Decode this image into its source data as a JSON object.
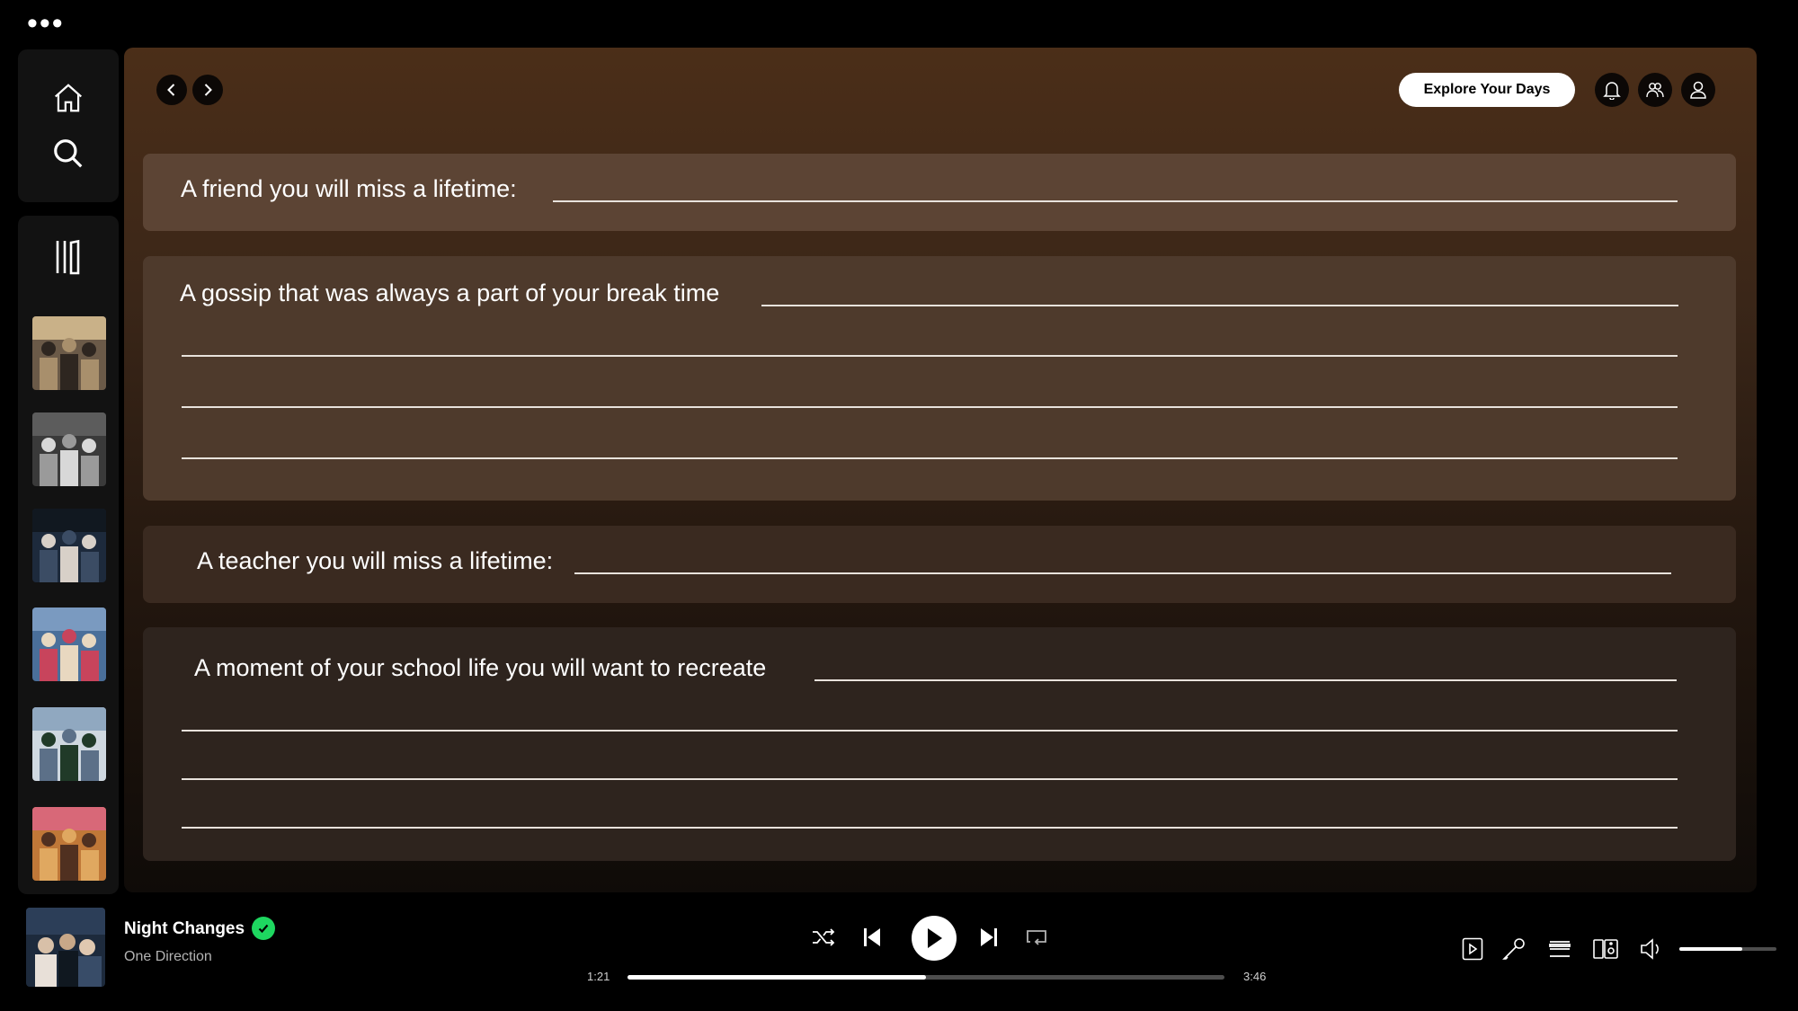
{
  "window": {
    "menu_icon": "more-dots-icon"
  },
  "nav": {
    "home_icon": "home-icon",
    "search_icon": "search-icon",
    "library_icon": "library-icon"
  },
  "library": {
    "thumbnails": [
      {
        "name": "group-photo-1",
        "palette": [
          "#6b5a48",
          "#a88f6c",
          "#2e2620",
          "#c9b188"
        ]
      },
      {
        "name": "black-white-collage",
        "palette": [
          "#3a3a3a",
          "#9a9a9a",
          "#d8d8d8",
          "#5c5c5c"
        ]
      },
      {
        "name": "group-photo-dark",
        "palette": [
          "#1d2a3c",
          "#3b4c64",
          "#d8d0c8",
          "#111820"
        ]
      },
      {
        "name": "group-photo-saree",
        "palette": [
          "#4a6f9a",
          "#c8445c",
          "#e8d8c0",
          "#7a9ac0"
        ]
      },
      {
        "name": "class-photo",
        "palette": [
          "#cfd8e0",
          "#5c7088",
          "#203a28",
          "#90a8c0"
        ]
      },
      {
        "name": "family-photo",
        "palette": [
          "#c07838",
          "#e0a860",
          "#503020",
          "#d86878"
        ]
      }
    ]
  },
  "header": {
    "explore_label": "Explore Your Days",
    "notification_icon": "bell-icon",
    "friends_icon": "friends-icon",
    "profile_icon": "user-icon"
  },
  "prompts": {
    "friend": "A friend you will miss a lifetime:",
    "gossip": "A gossip that was always a part of your break time",
    "teacher": "A teacher you will miss a lifetime:",
    "moment": "A moment of your school life you will want to recreate"
  },
  "now_playing": {
    "title": "Night Changes",
    "artist": "One Direction",
    "liked": true,
    "elapsed": "1:21",
    "duration": "3:46",
    "progress": 0.5,
    "volume": 0.65
  },
  "colors": {
    "accent_green": "#1ed760",
    "card_top": "#5a4535",
    "card_mid": "#4a3828"
  }
}
